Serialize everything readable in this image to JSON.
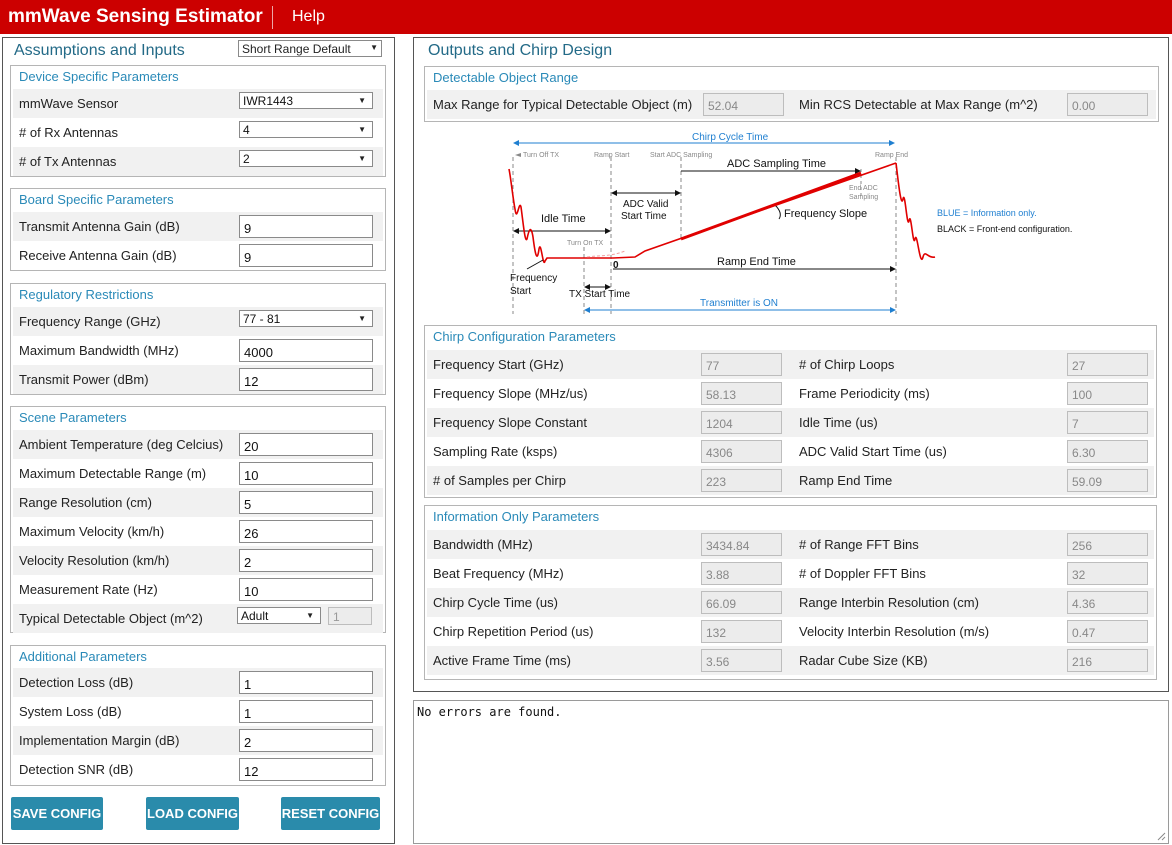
{
  "app": {
    "title": "mmWave Sensing Estimator",
    "help_label": "Help"
  },
  "left": {
    "title": "Assumptions and Inputs",
    "preset": "Short Range Default",
    "device": {
      "title": "Device Specific Parameters",
      "rows": [
        {
          "label": "mmWave Sensor",
          "value": "IWR1443"
        },
        {
          "label": "# of Rx Antennas",
          "value": "4"
        },
        {
          "label": "# of Tx Antennas",
          "value": "2"
        }
      ]
    },
    "board": {
      "title": "Board Specific Parameters",
      "rows": [
        {
          "label": "Transmit Antenna Gain (dB)",
          "value": "9"
        },
        {
          "label": "Receive Antenna Gain (dB)",
          "value": "9"
        }
      ]
    },
    "regulatory": {
      "title": "Regulatory Restrictions",
      "rows": [
        {
          "label": "Frequency Range (GHz)",
          "value": "77 - 81"
        },
        {
          "label": "Maximum Bandwidth (MHz)",
          "value": "4000"
        },
        {
          "label": "Transmit Power (dBm)",
          "value": "12"
        }
      ]
    },
    "scene": {
      "title": "Scene Parameters",
      "rows": [
        {
          "label": "Ambient Temperature (deg Celcius)",
          "value": "20"
        },
        {
          "label": "Maximum Detectable Range (m)",
          "value": "10"
        },
        {
          "label": "Range Resolution (cm)",
          "value": "5"
        },
        {
          "label": "Maximum Velocity (km/h)",
          "value": "26"
        },
        {
          "label": "Velocity Resolution (km/h)",
          "value": "2"
        },
        {
          "label": "Measurement Rate (Hz)",
          "value": "10"
        },
        {
          "label": "Typical Detectable Object (m^2)",
          "value": "Adult",
          "extra": "1"
        }
      ]
    },
    "additional": {
      "title": "Additional Parameters",
      "rows": [
        {
          "label": "Detection Loss (dB)",
          "value": "1"
        },
        {
          "label": "System Loss (dB)",
          "value": "1"
        },
        {
          "label": "Implementation Margin (dB)",
          "value": "2"
        },
        {
          "label": "Detection SNR (dB)",
          "value": "12"
        }
      ]
    },
    "buttons": {
      "save": "SAVE CONFIG",
      "load": "LOAD CONFIG",
      "reset": "RESET CONFIG"
    }
  },
  "right": {
    "title": "Outputs and Chirp Design",
    "range": {
      "title": "Detectable Object Range",
      "max_range_label": "Max Range for Typical Detectable Object (m)",
      "max_range_value": "52.04",
      "min_rcs_label": "Min RCS Detectable at Max Range (m^2)",
      "min_rcs_value": "0.00"
    },
    "diagram": {
      "chirp_cycle_time": "Chirp Cycle Time",
      "turn_off_tx": "Turn Off TX",
      "ramp_start": "Ramp Start",
      "start_adc_sampling": "Start ADC Sampling",
      "ramp_end": "Ramp End",
      "adc_sampling_time": "ADC Sampling Time",
      "end_adc_1": "End ADC",
      "end_adc_2": "Sampling",
      "adc_valid_1": "ADC Valid",
      "adc_valid_2": "Start Time",
      "frequency_slope": "Frequency Slope",
      "idle_time": "Idle Time",
      "turn_on_tx": "Turn On TX",
      "zero": "0",
      "ramp_end_time": "Ramp End Time",
      "freq_start_1": "Frequency",
      "freq_start_2": "Start",
      "tx_start_time": "TX Start Time",
      "transmitter_on": "Transmitter is ON",
      "legend_blue": "BLUE = Information only.",
      "legend_black": "BLACK = Front-end configuration."
    },
    "chirp": {
      "title": "Chirp Configuration Parameters",
      "rows": [
        {
          "l1": "Frequency Start (GHz)",
          "v1": "77",
          "l2": "# of Chirp Loops",
          "v2": "27"
        },
        {
          "l1": "Frequency Slope (MHz/us)",
          "v1": "58.13",
          "l2": "Frame Periodicity (ms)",
          "v2": "100"
        },
        {
          "l1": "Frequency Slope Constant",
          "v1": "1204",
          "l2": "Idle Time (us)",
          "v2": "7"
        },
        {
          "l1": "Sampling Rate (ksps)",
          "v1": "4306",
          "l2": "ADC Valid Start Time (us)",
          "v2": "6.30"
        },
        {
          "l1": "# of Samples per Chirp",
          "v1": "223",
          "l2": "Ramp End Time",
          "v2": "59.09"
        }
      ]
    },
    "info": {
      "title": "Information Only Parameters",
      "rows": [
        {
          "l1": "Bandwidth (MHz)",
          "v1": "3434.84",
          "l2": "# of Range FFT Bins",
          "v2": "256"
        },
        {
          "l1": "Beat Frequency (MHz)",
          "v1": "3.88",
          "l2": "# of Doppler FFT Bins",
          "v2": "32"
        },
        {
          "l1": "Chirp Cycle Time (us)",
          "v1": "66.09",
          "l2": "Range Interbin Resolution (cm)",
          "v2": "4.36"
        },
        {
          "l1": "Chirp Repetition Period (us)",
          "v1": "132",
          "l2": "Velocity Interbin Resolution (m/s)",
          "v2": "0.47"
        },
        {
          "l1": "Active Frame Time (ms)",
          "v1": "3.56",
          "l2": "Radar Cube Size (KB)",
          "v2": "216"
        }
      ]
    }
  },
  "console": {
    "text": "No errors are found."
  },
  "colors": {
    "brand": "#cc0000",
    "accent": "#2a8bab",
    "section_title": "#2a8ab8",
    "chirp_line": "#e00000",
    "info_blue": "#1f7fd0"
  }
}
